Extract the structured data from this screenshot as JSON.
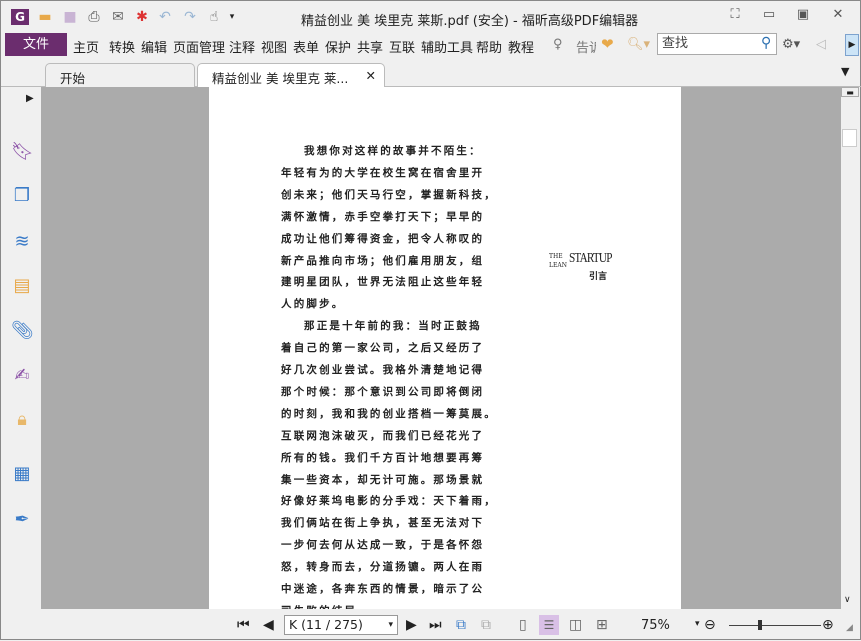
{
  "window": {
    "title": "精益创业 美 埃里克 莱斯.pdf (安全) - 福昕高级PDF编辑器"
  },
  "menu": {
    "file": "文件",
    "items": [
      "主页",
      "转换",
      "编辑",
      "页面管理",
      "注释",
      "视图",
      "表单",
      "保护",
      "共享",
      "互联",
      "辅助工具",
      "帮助",
      "教程"
    ],
    "tell_me": "告诉",
    "search_placeholder": "查找"
  },
  "tabs": [
    {
      "label": "开始",
      "active": false
    },
    {
      "label": "精益创业 美 埃里克 莱...",
      "active": true
    }
  ],
  "document": {
    "logo": {
      "the": "THE",
      "lean": "LEAN",
      "startup": "STARTUP",
      "subtitle": "引言"
    },
    "lines": [
      "我想你对这样的故事并不陌生：",
      "年轻有为的大学在校生窝在宿舍里开",
      "创未来；他们天马行空，掌握新科技，",
      "满怀激情，赤手空拳打天下；早早的",
      "成功让他们筹得资金，把令人称叹的",
      "新产品推向市场；他们雇用朋友，组",
      "建明星团队，世界无法阻止这些年轻",
      "人的脚步。",
      "那正是十年前的我：当时正鼓捣",
      "着自己的第一家公司，之后又经历了",
      "好几次创业尝试。我格外清楚地记得",
      "那个时候：那个意识到公司即将倒闭",
      "的时刻，我和我的创业搭档一筹莫展。",
      "互联网泡沫破灭，而我们已经花光了",
      "所有的钱。我们千方百计地想要再筹",
      "集一些资本，却无计可施。那场景就",
      "好像好莱坞电影的分手戏：天下着雨，",
      "我们俩站在街上争执，甚至无法对下",
      "一步何去何从达成一致，于是各怀怨",
      "怒，转身而去，分道扬镳。两人在雨",
      "中迷途，各奔东西的情景，暗示了公",
      "司失败的结局。"
    ]
  },
  "statusbar": {
    "page": "K (11 / 275)",
    "zoom": "75%",
    "zoom_level": 75
  },
  "colors": {
    "brand": "#6b2d6e",
    "active_view": "#d9c0e6"
  }
}
